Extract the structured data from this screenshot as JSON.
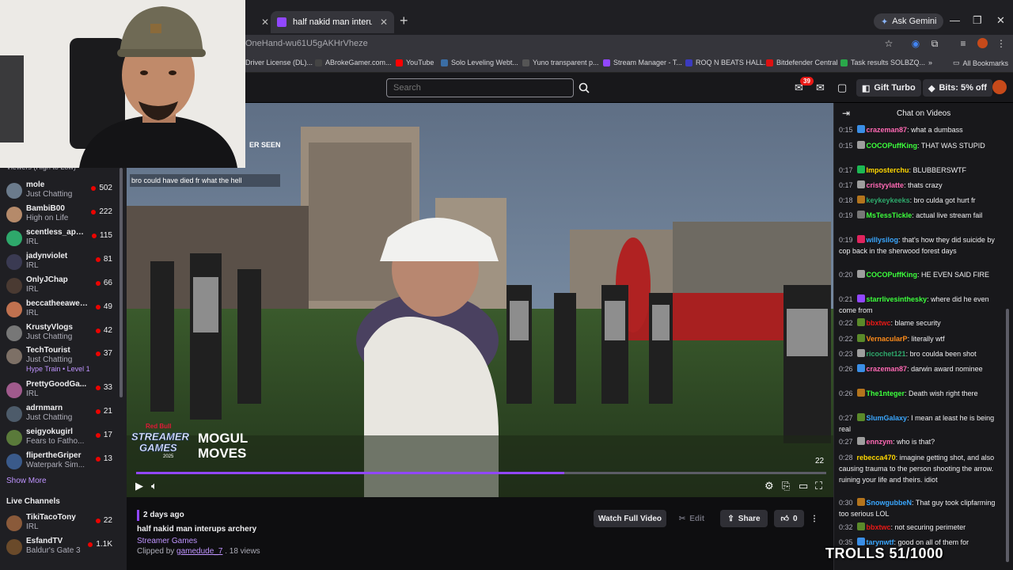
{
  "browser": {
    "tabs": [
      {
        "label": "",
        "active": false
      },
      {
        "label": "half nakid man interupts archer",
        "active": true
      }
    ],
    "ask_gemini": "Ask Gemini",
    "url": "OneHand-wu61U5gAKHrVheze",
    "bookmarks": [
      {
        "label": "Driver License (DL)...",
        "color": "#888"
      },
      {
        "label": "ABrokeGamer.com...",
        "color": "#444"
      },
      {
        "label": "YouTube",
        "color": "#ff0000"
      },
      {
        "label": "Solo Leveling Webt...",
        "color": "#3b6ea5"
      },
      {
        "label": "Yuno transparent p...",
        "color": "#555"
      },
      {
        "label": "Stream Manager - T...",
        "color": "#9147ff"
      },
      {
        "label": "ROQ N BEATS HALL...",
        "color": "#3b3bbf"
      },
      {
        "label": "Bitdefender Central",
        "color": "#d11"
      },
      {
        "label": "Task results SOLBZQ...",
        "color": "#2aa84a"
      },
      {
        "label": "All Bookmarks",
        "color": "#aaa"
      }
    ]
  },
  "header": {
    "search_placeholder": "Search",
    "notifications_count": "39",
    "gift_turbo": "Gift Turbo",
    "bits": "Bits: 5% off"
  },
  "sidebar": {
    "header": "Viewers (High to Low)",
    "channels": [
      {
        "name": "mole",
        "category": "Just Chatting",
        "viewers": "502",
        "color": "#6b7b8c"
      },
      {
        "name": "BambiB00",
        "category": "High on Life",
        "viewers": "222",
        "color": "#b58a6a"
      },
      {
        "name": "scentless_appr...",
        "category": "IRL",
        "viewers": "115",
        "color": "#2ea86b"
      },
      {
        "name": "jadynviolet",
        "category": "IRL",
        "viewers": "81",
        "color": "#3a3a52"
      },
      {
        "name": "OnlyJChap",
        "category": "IRL",
        "viewers": "66",
        "color": "#4a3a32"
      },
      {
        "name": "beccatheeawes...",
        "category": "IRL",
        "viewers": "49",
        "color": "#c0714f"
      },
      {
        "name": "KrustyVlogs",
        "category": "Just Chatting",
        "viewers": "42",
        "color": "#777"
      },
      {
        "name": "TechTourist",
        "category": "Just Chatting",
        "viewers": "37",
        "color": "#7d7066",
        "extra": "Hype Train • Level 1"
      },
      {
        "name": "PrettyGoodGa...",
        "category": "IRL",
        "viewers": "33",
        "color": "#a05a8c"
      },
      {
        "name": "adrnmarn",
        "category": "Just Chatting",
        "viewers": "21",
        "color": "#4d5b6a"
      },
      {
        "name": "seigyokugirl",
        "category": "Fears to Fatho...",
        "viewers": "17",
        "color": "#5a7a3a"
      },
      {
        "name": "flipertheGriper",
        "category": "Waterpark Sim...",
        "viewers": "13",
        "color": "#3a5a8a"
      }
    ],
    "show_more": "Show More",
    "live_channels_label": "Live Channels",
    "live_channels": [
      {
        "name": "TikiTacoTony",
        "category": "IRL",
        "viewers": "22",
        "color": "#8a5a3a"
      },
      {
        "name": "EsfandTV",
        "category": "Baldur's Gate 3",
        "viewers": "1.1K",
        "color": "#6a4a2a"
      }
    ]
  },
  "video": {
    "overlay_fragment": "ER SEEN",
    "overlay_chat_line": "bro could have died fr what the hell",
    "logo_top": "Red Bull",
    "logo_mid": "STREAMER",
    "logo_bottom": "GAMES",
    "logo_year": "2025",
    "logo_right_1": "MOGUL",
    "logo_right_2": "MOVES",
    "timecode": "22",
    "progress": 0.62
  },
  "clip": {
    "date": "2 days ago",
    "title": "half nakid man interups archery",
    "game": "Streamer Games",
    "clipped_by_prefix": "Clipped by",
    "clipped_by_user": "gamedude_7",
    "views": " . 18 views",
    "watch_full": "Watch Full Video",
    "edit": "Edit",
    "share": "Share",
    "likes": "0"
  },
  "chat": {
    "title": "Chat on Videos",
    "messages": [
      {
        "time": "0:15",
        "user": "crazeman87",
        "color": "#ff69b4",
        "text": ": what a dumbass",
        "badge": "#3a8ee6"
      },
      {
        "time": "0:15",
        "user": "COCOPuffKing",
        "color": "#3cff3c",
        "text": ": THAT WAS STUPID",
        "badge": "#9e9e9e"
      },
      {
        "time": "0:17",
        "user": "Imposterchu",
        "color": "#ffd800",
        "text": ": BLUBBERSWTF",
        "badge": "#1db954"
      },
      {
        "time": "0:17",
        "user": "cristyylatte",
        "color": "#ff69b4",
        "text": ": thats crazy",
        "badge": "#9e9e9e"
      },
      {
        "time": "0:18",
        "user": "keykeykeeks",
        "color": "#2ea86b",
        "text": ": bro culda got hurt fr",
        "badge": "#b3741d"
      },
      {
        "time": "0:19",
        "user": "MsTessTickle",
        "color": "#3cff3c",
        "text": ": actual live stream fail",
        "badge": "#777"
      },
      {
        "time": "0:19",
        "user": "willysilog",
        "color": "#3aa7ff",
        "text": ": that's how they did suicide by cop back in the sherwood forest days",
        "badge": "#e0245e"
      },
      {
        "time": "0:20",
        "user": "COCOPuffKing",
        "color": "#3cff3c",
        "text": ": HE EVEN SAID FIRE",
        "badge": "#9e9e9e"
      },
      {
        "time": "0:21",
        "user": "starrlivesinthesky",
        "color": "#3cff3c",
        "text": ": where did he even come from",
        "badge": "#9147ff"
      },
      {
        "time": "0:22",
        "user": "bbxtwc",
        "color": "#e91916",
        "text": ": blame security",
        "badge": "#5a8a2a"
      },
      {
        "time": "0:22",
        "user": "VernacularP",
        "color": "#ff8c1a",
        "text": ": literally wtf",
        "badge": "#5a8a2a"
      },
      {
        "time": "0:23",
        "user": "ricochet121",
        "color": "#2ea86b",
        "text": ": bro coulda been shot",
        "badge": "#9e9e9e"
      },
      {
        "time": "0:26",
        "user": "crazeman87",
        "color": "#ff69b4",
        "text": ": darwin award nominee",
        "badge": "#3a8ee6"
      },
      {
        "time": "0:26",
        "user": "The1nteger",
        "color": "#3cff3c",
        "text": ": Death wish right there",
        "badge": "#b3741d"
      },
      {
        "time": "0:27",
        "user": "SlumGalaxy",
        "color": "#3aa7ff",
        "text": ": I mean at least he is being real",
        "badge": "#5a8a2a"
      },
      {
        "time": "0:27",
        "user": "ennzym",
        "color": "#ff69b4",
        "text": ": who is that?",
        "badge": "#9e9e9e"
      },
      {
        "time": "0:28",
        "user": "rebecca470",
        "color": "#ffd800",
        "text": ": imagine getting shot, and also causing trauma to the person shooting the arrow. ruining your life and theirs. idiot",
        "badge": ""
      },
      {
        "time": "0:30",
        "user": "SnowgubbeN",
        "color": "#3aa7ff",
        "text": ": That guy took clipfarming too serious LOL",
        "badge": "#b3741d"
      },
      {
        "time": "0:32",
        "user": "bbxtwc",
        "color": "#e91916",
        "text": ": not securing perimeter",
        "badge": "#5a8a2a"
      },
      {
        "time": "0:35",
        "user": "tarynwtf",
        "color": "#3aa7ff",
        "text": ": good on all of them for",
        "badge": "#3a8ee6"
      }
    ]
  },
  "overlay_trolls": "TROLLS 51/1000"
}
